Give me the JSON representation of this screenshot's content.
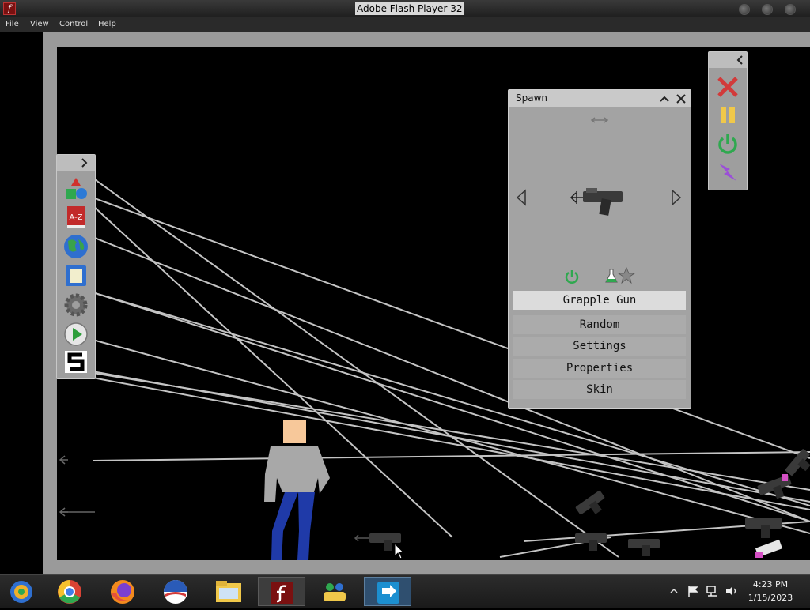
{
  "window": {
    "title": "Adobe Flash Player 32",
    "app_icon_glyph": "f"
  },
  "menubar": {
    "items": [
      "File",
      "View",
      "Control",
      "Help"
    ]
  },
  "left_toolbar": {
    "icons": [
      "shapes-icon",
      "dictionary-icon",
      "world-icon",
      "save-icon",
      "settings-gear-icon",
      "play-icon",
      "logo-s-icon"
    ]
  },
  "right_toolbar": {
    "icons": [
      "clear-x-icon",
      "pause-icon",
      "power-icon",
      "lightning-icon"
    ]
  },
  "spawn_panel": {
    "title": "Spawn",
    "item_name": "Grapple Gun",
    "menu": [
      "Random",
      "Settings",
      "Properties",
      "Skin"
    ]
  },
  "taskbar": {
    "apps": [
      "media-player-icon",
      "chrome-icon",
      "firefox-icon",
      "obama-logo-icon",
      "file-explorer-icon",
      "flash-player-icon",
      "messenger-icon",
      "remote-app-icon"
    ],
    "time": "4:23 PM",
    "date": "1/15/2023"
  },
  "colors": {
    "stage_bg": "#000000",
    "panel_bg": "#a3a3a3",
    "selected_row": "#dcdcdc",
    "rope": "#c8c8c8"
  }
}
